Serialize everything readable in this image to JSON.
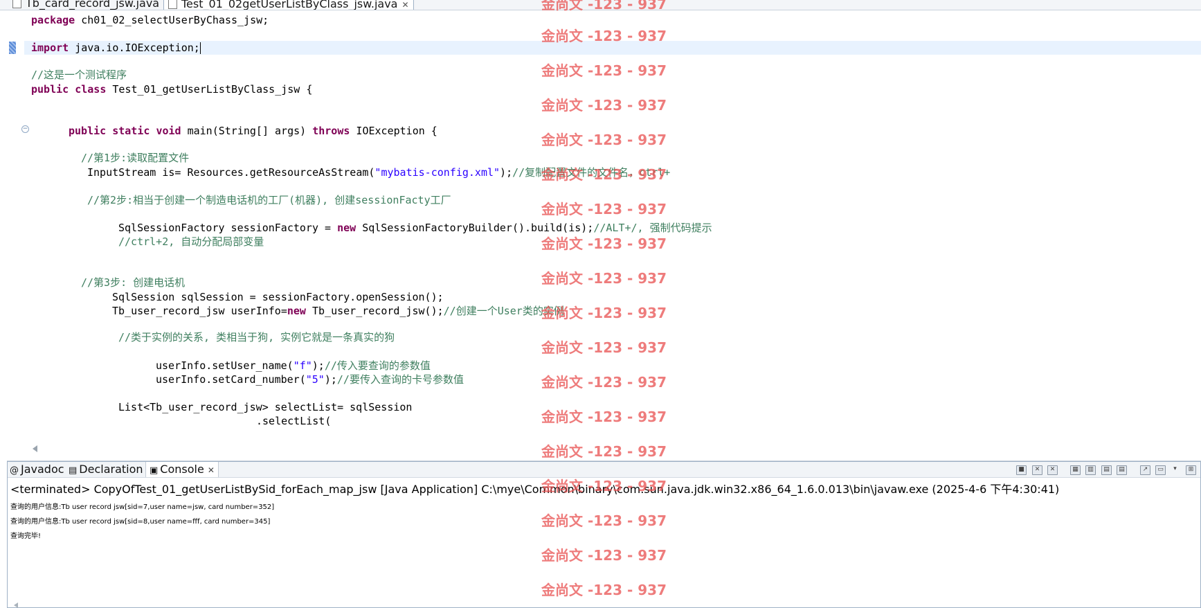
{
  "editor_tabs": [
    {
      "label": "Tb_card_record_jsw.java",
      "active": false
    },
    {
      "label": "Test_01_02getUserListByClass_jsw.java",
      "active": true
    }
  ],
  "code": {
    "l1": {
      "kw": "package",
      "rest": " ch01_02_selectUserByChass_jsw;"
    },
    "l2": {
      "kw": "import",
      "rest": " java.io.IOException;"
    },
    "l3": {
      "comment": "//这是一个测试程序"
    },
    "l4": {
      "kw1": "public",
      "kw2": "class",
      "rest": " Test_01_getUserListByClass_jsw {"
    },
    "l5": {
      "kw1": "public",
      "kw2": "static",
      "kw3": "void",
      "mid": " main(String[] args) ",
      "kw4": "throws",
      "rest": " IOException {"
    },
    "l6": {
      "comment": "//第1步:读取配置文件"
    },
    "l7": {
      "pre": "InputStream is= Resources.getResourceAsStream(",
      "str": "\"mybatis-config.xml\"",
      "post": ");",
      "comment": "//复制配置文件的文件名，ctrl+"
    },
    "l8": {
      "comment": "//第2步:相当于创建一个制造电话机的工厂(机器), 创建sessionFacty工厂"
    },
    "l9": {
      "pre": "SqlSessionFactory sessionFactory = ",
      "kw": "new",
      "post": " SqlSessionFactoryBuilder().build(is);",
      "comment": "//ALT+/, 强制代码提示"
    },
    "l10": {
      "comment": "//ctrl+2, 自动分配局部变量"
    },
    "l11": {
      "comment": "//第3步: 创建电话机"
    },
    "l12": {
      "text": "SqlSession sqlSession = sessionFactory.openSession();"
    },
    "l13": {
      "pre": "Tb_user_record_jsw userInfo=",
      "kw": "new",
      "post": " Tb_user_record_jsw();",
      "comment": "//创建一个User类的实例"
    },
    "l14": {
      "comment": "//类于实例的关系, 类相当于狗, 实例它就是一条真实的狗"
    },
    "l15": {
      "pre": "userInfo.setUser_name(",
      "str": "\"f\"",
      "post": ");",
      "comment": "//传入要查询的参数值"
    },
    "l16": {
      "pre": "userInfo.setCard_number(",
      "str": "\"5\"",
      "post": ");",
      "comment": "//要传入查询的卡号参数值"
    },
    "l17": {
      "text": "List<Tb_user_record_jsw> selectList= sqlSession"
    },
    "l18": {
      "text": ".selectList("
    }
  },
  "console": {
    "tabs": [
      {
        "label": "Javadoc",
        "icon": "at-icon"
      },
      {
        "label": "Declaration",
        "icon": "declaration-icon"
      },
      {
        "label": "Console",
        "icon": "console-icon"
      }
    ],
    "status": "<terminated> CopyOfTest_01_getUserListBySid_forEach_map_jsw [Java Application] C:\\mye\\Common\\binary\\com.sun.java.jdk.win32.x86_64_1.6.0.013\\bin\\javaw.exe (2025-4-6 下午4:30:41)",
    "output": [
      "查询的用户信息:Tb user record jsw[sid=7,user name=jsw, card number=352]",
      "查询的用户信息:Tb user record jsw[sid=8,user name=fff, card number=345]",
      "查询完毕!"
    ]
  },
  "watermark": {
    "text": "金尚文 -123 - 937"
  },
  "colors": {
    "keyword": "#7f0055",
    "string": "#2a00ff",
    "comment": "#3f7f5f",
    "watermark": "#e85050",
    "current_line": "#e8f2fe"
  }
}
